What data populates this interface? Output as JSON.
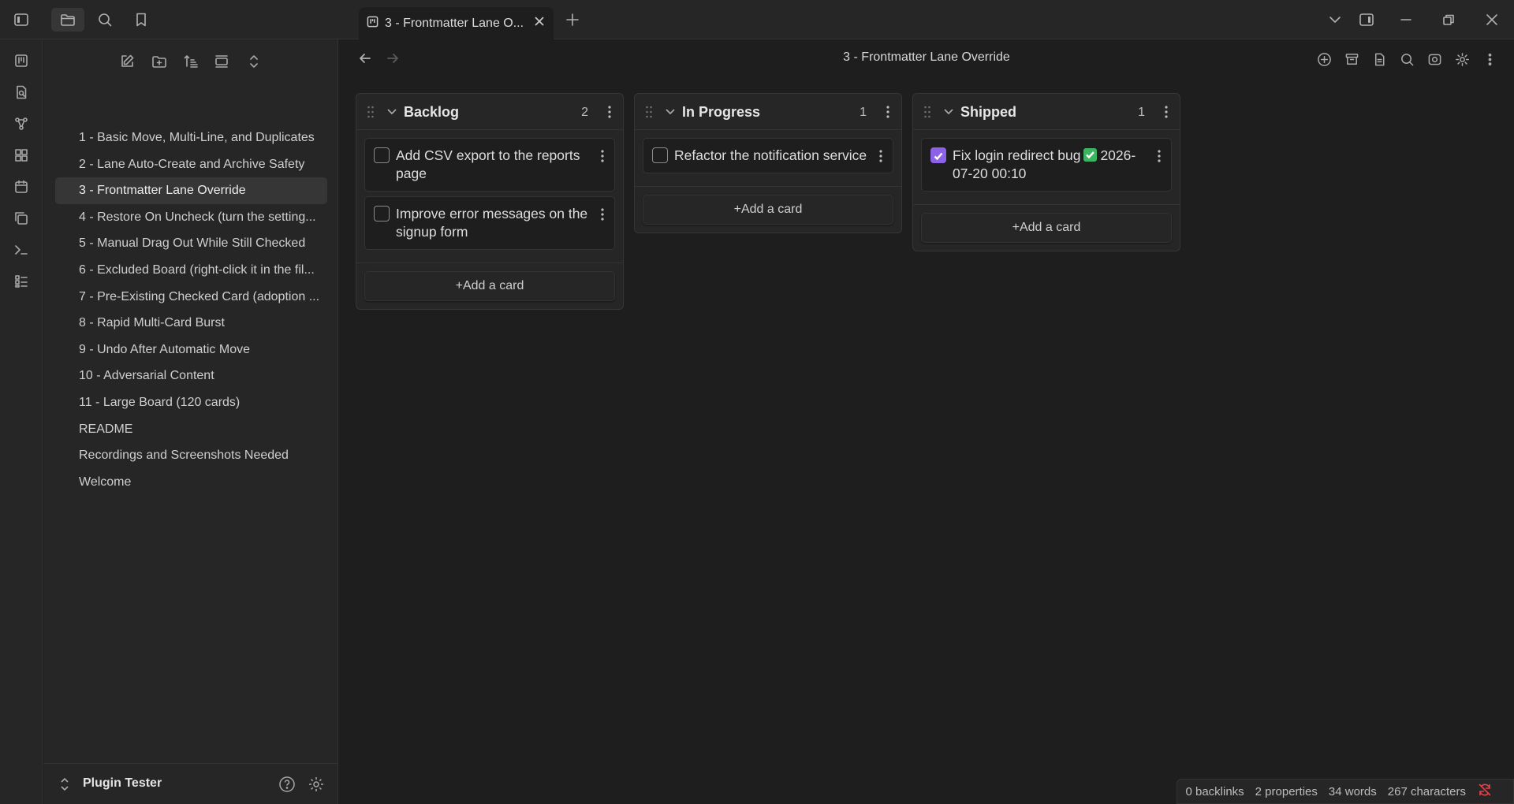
{
  "titlebar": {
    "tab_title": "3 - Frontmatter Lane O...",
    "icons": [
      "sidebar-toggle-icon",
      "folder-icon",
      "search-icon",
      "bookmark-icon",
      "new-tab-icon",
      "chevron-down-icon",
      "right-sidebar-icon",
      "minimize-icon",
      "restore-icon",
      "close-icon"
    ]
  },
  "ribbon": {
    "icons": [
      "kanban-icon",
      "file-search-icon",
      "graph-icon",
      "blocks-icon",
      "calendar-icon",
      "copy-icon",
      "terminal-icon",
      "list-icon"
    ]
  },
  "sidebar": {
    "actions": [
      "new-note-icon",
      "new-folder-icon",
      "sort-icon",
      "collapse-icon",
      "expand-icon"
    ],
    "files": [
      {
        "label": "1 - Basic Move, Multi-Line, and Duplicates"
      },
      {
        "label": "2 - Lane Auto-Create and Archive Safety"
      },
      {
        "label": "3 - Frontmatter Lane Override"
      },
      {
        "label": "4 - Restore On Uncheck (turn the setting..."
      },
      {
        "label": "5 - Manual Drag Out While Still Checked"
      },
      {
        "label": "6 - Excluded Board (right-click it in the fil..."
      },
      {
        "label": "7 - Pre-Existing Checked Card (adoption ..."
      },
      {
        "label": "8 - Rapid Multi-Card Burst"
      },
      {
        "label": "9 - Undo After Automatic Move"
      },
      {
        "label": "10 - Adversarial Content"
      },
      {
        "label": "11 - Large Board (120 cards)"
      },
      {
        "label": "README"
      },
      {
        "label": "Recordings and Screenshots Needed"
      },
      {
        "label": "Welcome"
      }
    ],
    "active_index": 2,
    "vault_name": "Plugin Tester"
  },
  "view": {
    "title": "3 - Frontmatter Lane Override"
  },
  "board": {
    "add_card_label": "+Add a card",
    "lanes": [
      {
        "title": "Backlog",
        "count": "2",
        "cards": [
          {
            "text": "Add CSV export to the reports page",
            "checked": false
          },
          {
            "text": "Improve error messages on the signup form",
            "checked": false
          }
        ]
      },
      {
        "title": "In Progress",
        "count": "1",
        "cards": [
          {
            "text": "Refactor the notification service",
            "checked": false
          }
        ]
      },
      {
        "title": "Shipped",
        "count": "1",
        "cards": [
          {
            "text": "Fix login redirect bug",
            "date": "2026-07-20 00:10",
            "checked": true
          }
        ]
      }
    ]
  },
  "statusbar": {
    "backlinks": "0 backlinks",
    "properties": "2 properties",
    "words": "34 words",
    "characters": "267 characters"
  },
  "colors": {
    "accent": "#8c63e6",
    "done_emoji": "#3bb560",
    "sync_error": "#e0444a"
  }
}
